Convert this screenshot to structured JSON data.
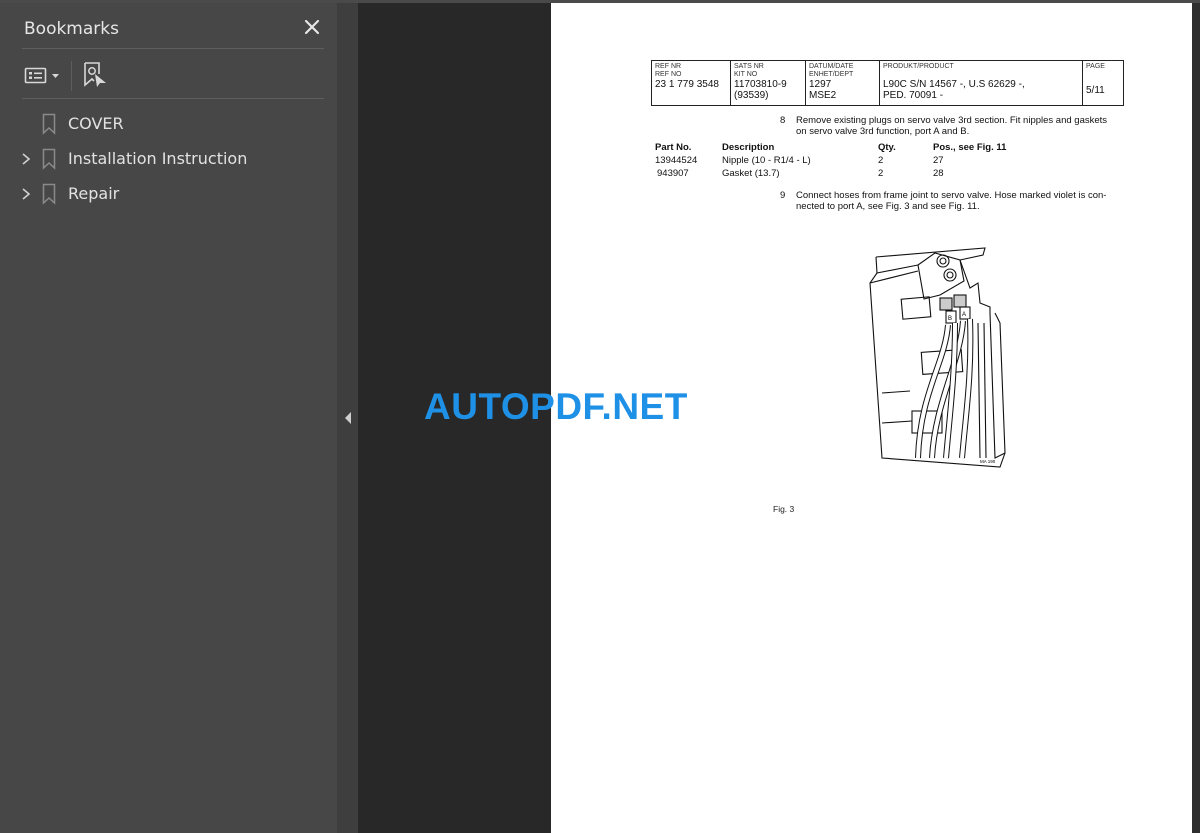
{
  "sidebar": {
    "title": "Bookmarks",
    "close_icon": "close-icon",
    "tools": [
      {
        "name": "options-menu",
        "icon": "list-options-icon"
      },
      {
        "name": "find-current-bookmark",
        "icon": "bookmark-find-icon"
      }
    ],
    "bookmarks": [
      {
        "label": "COVER",
        "expandable": false
      },
      {
        "label": "Installation Instruction",
        "expandable": true
      },
      {
        "label": "Repair",
        "expandable": true
      }
    ]
  },
  "document": {
    "header": {
      "ref_label1": "REF NR",
      "ref_label2": "REF NO",
      "ref_value": "23 1 779 3548",
      "kit_label1": "SATS NR",
      "kit_label2": "KIT NO",
      "kit_value1": "11703810-9",
      "kit_value2": "(93539)",
      "date_label1": "DATUM/DATE",
      "date_label2": "ENHET/DEPT",
      "date_value1": "1297",
      "date_value2": "MSE2",
      "product_label": "PRODUKT/PRODUCT",
      "product_value1": "L90C   S/N 14567 -,  U.S  62629 -,",
      "product_value2": "PED. 70091 -",
      "page_label": "PAGE",
      "page_value": "5/11"
    },
    "step8": {
      "number": "8",
      "line1": "Remove existing plugs on servo valve 3rd section. Fit nipples and gaskets",
      "line2": "on servo valve 3rd function, port A and B."
    },
    "parts_table": {
      "headers": [
        "Part No.",
        "Description",
        "Qty.",
        "Pos., see Fig. 11"
      ],
      "rows": [
        [
          "13944524",
          "Nipple (10 - R1/4 - L)",
          "2",
          "27"
        ],
        [
          " 943907",
          "Gasket (13.7)",
          "2",
          "28"
        ]
      ]
    },
    "step9": {
      "number": "9",
      "line1": "Connect hoses from frame joint to servo valve. Hose marked violet is con-",
      "line2": "nected to port A, see Fig. 3 and see Fig. 11."
    },
    "figure": {
      "port_a": "A",
      "port_b": "B",
      "code": "MA 190",
      "caption": "Fig. 3"
    }
  },
  "watermark": "AUTOPDF.NET"
}
